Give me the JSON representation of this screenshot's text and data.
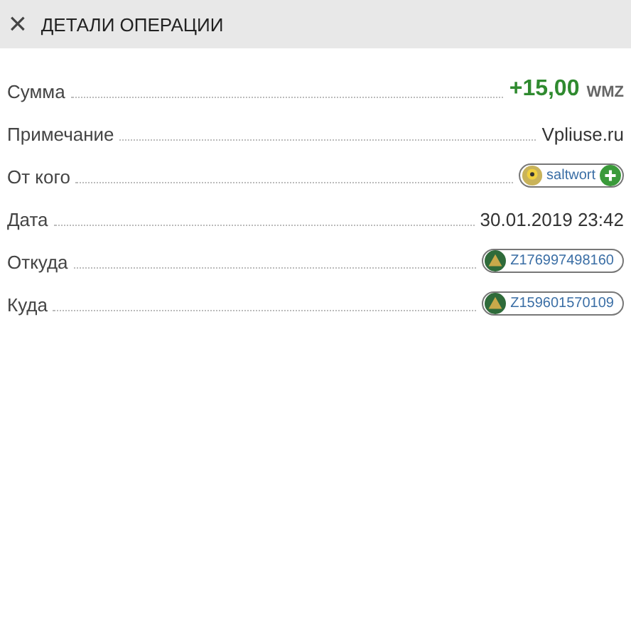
{
  "header": {
    "close_icon": "×",
    "title": "ДЕТАЛИ ОПЕРАЦИИ"
  },
  "rows": [
    {
      "label": "Сумма",
      "kind": "amount",
      "value": "+15,00",
      "unit": "WMZ"
    },
    {
      "label": "Примечание",
      "kind": "text",
      "value": "Vpliuse.ru"
    },
    {
      "label": "От кого",
      "kind": "user",
      "value": "saltwort"
    },
    {
      "label": "Дата",
      "kind": "text",
      "value": "30.01.2019 23:42"
    },
    {
      "label": "Откуда",
      "kind": "purse",
      "value": "Z176997498160"
    },
    {
      "label": "Куда",
      "kind": "purse",
      "value": "Z159601570109"
    }
  ]
}
